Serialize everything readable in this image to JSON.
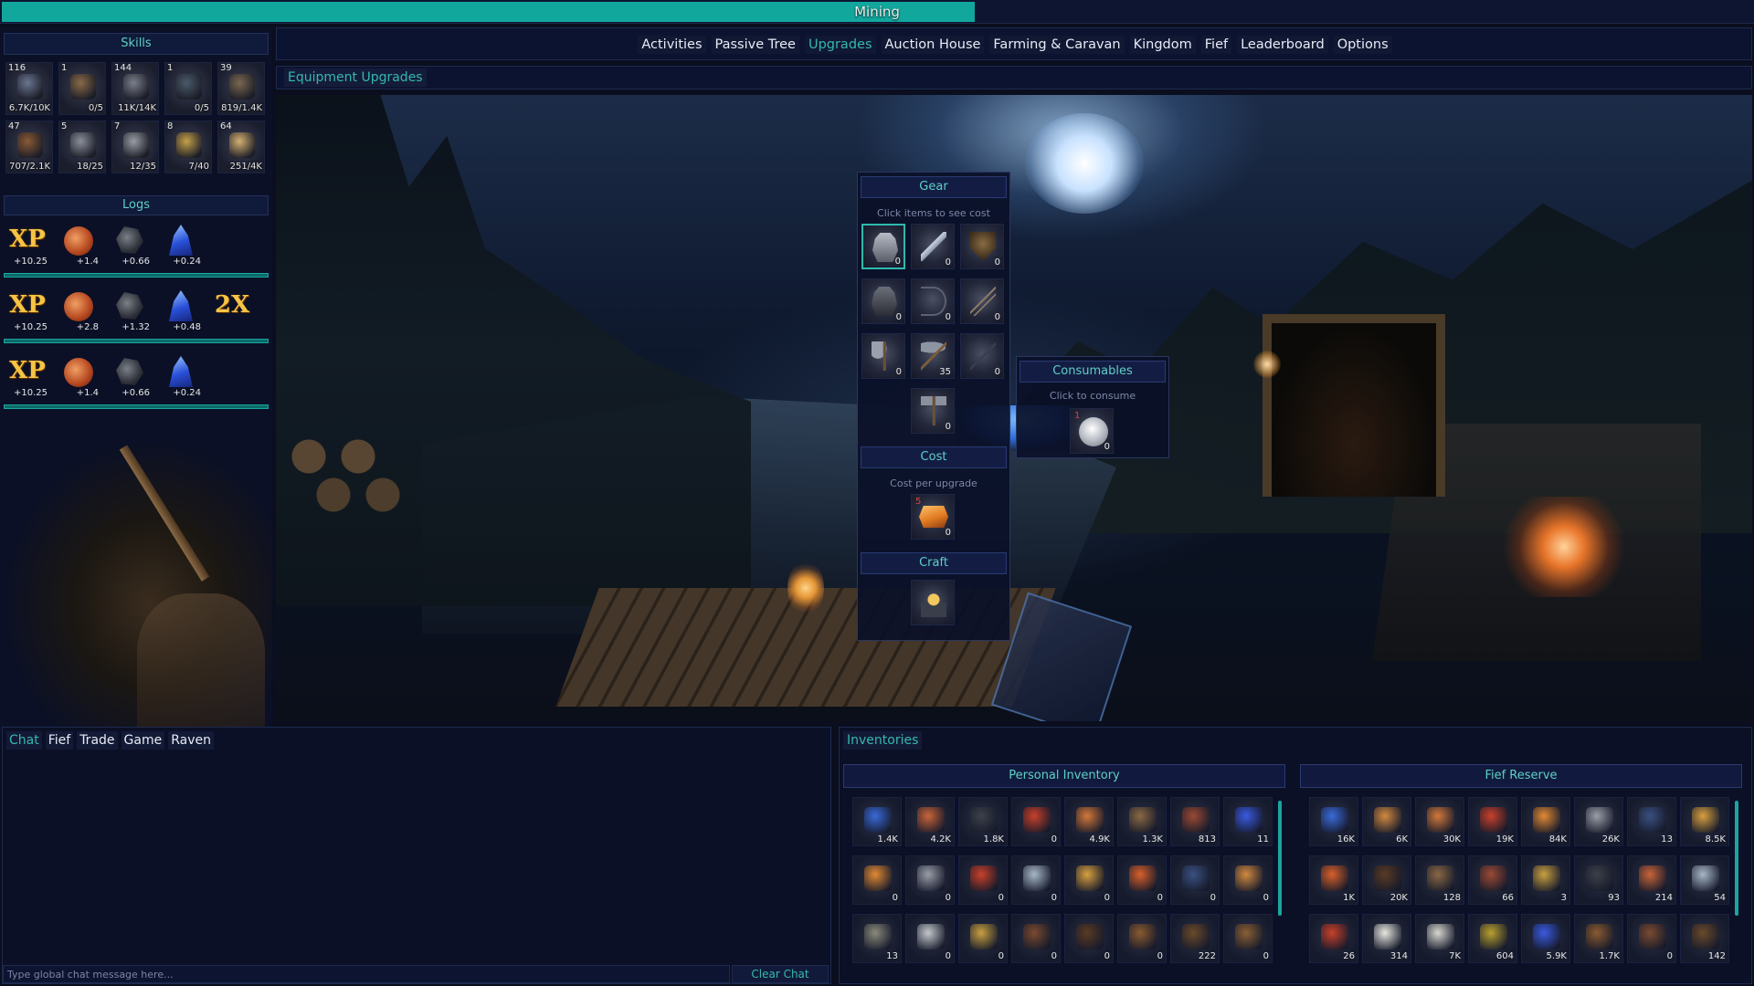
{
  "top_bar": {
    "title": "Mining",
    "progress_fraction": 0.556,
    "color": "#12a79d"
  },
  "left": {
    "skills_title": "Skills",
    "skills": [
      {
        "level": "116",
        "progress": "6.7K/10K",
        "icon": "stag-icon",
        "color": "#6a7590"
      },
      {
        "level": "1",
        "progress": "0/5",
        "icon": "wood-axe-icon",
        "color": "#8a6a48"
      },
      {
        "level": "144",
        "progress": "11K/14K",
        "icon": "pickaxe-icon",
        "color": "#7a7f8c"
      },
      {
        "level": "1",
        "progress": "0/5",
        "icon": "fishing-net-icon",
        "color": "#4a5a6a"
      },
      {
        "level": "39",
        "progress": "819/1.4K",
        "icon": "fishing-rod-icon",
        "color": "#7a6850"
      },
      {
        "level": "47",
        "progress": "707/2.1K",
        "icon": "crafting-chest-icon",
        "color": "#8a5a34"
      },
      {
        "level": "5",
        "progress": "18/25",
        "icon": "crossed-swords-icon",
        "color": "#8a8f9a"
      },
      {
        "level": "7",
        "progress": "12/35",
        "icon": "armor-icon",
        "color": "#9a9ca4"
      },
      {
        "level": "8",
        "progress": "7/40",
        "icon": "anvil-icon",
        "color": "#c4a04a"
      },
      {
        "level": "64",
        "progress": "251/4K",
        "icon": "scroll-icon",
        "color": "#d4b070"
      }
    ],
    "logs_title": "Logs",
    "log_rows": [
      {
        "items": [
          {
            "kind": "xp",
            "label": "XP",
            "amount": "+10.25"
          },
          {
            "kind": "ore",
            "amount": "+1.4"
          },
          {
            "kind": "coal",
            "amount": "+0.66"
          },
          {
            "kind": "crys",
            "amount": "+0.24"
          }
        ]
      },
      {
        "items": [
          {
            "kind": "xp",
            "label": "XP",
            "amount": "+10.25"
          },
          {
            "kind": "ore",
            "amount": "+2.8"
          },
          {
            "kind": "coal",
            "amount": "+1.32"
          },
          {
            "kind": "crys",
            "amount": "+0.48"
          },
          {
            "kind": "mult",
            "label": "2X",
            "amount": ""
          }
        ]
      },
      {
        "items": [
          {
            "kind": "xp",
            "label": "XP",
            "amount": "+10.25"
          },
          {
            "kind": "ore",
            "amount": "+1.4"
          },
          {
            "kind": "coal",
            "amount": "+0.66"
          },
          {
            "kind": "crys",
            "amount": "+0.24"
          }
        ]
      }
    ]
  },
  "nav": {
    "tabs": [
      {
        "label": "Activities",
        "active": false
      },
      {
        "label": "Passive Tree",
        "active": false
      },
      {
        "label": "Upgrades",
        "active": true
      },
      {
        "label": "Auction House",
        "active": false
      },
      {
        "label": "Farming & Caravan",
        "active": false
      },
      {
        "label": "Kingdom",
        "active": false
      },
      {
        "label": "Fief",
        "active": false
      },
      {
        "label": "Leaderboard",
        "active": false
      },
      {
        "label": "Options",
        "active": false
      }
    ]
  },
  "sub_title": "Equipment Upgrades",
  "gear": {
    "title": "Gear",
    "hint": "Click items to see cost",
    "slots": [
      {
        "icon": "plate-armor-icon",
        "count": "0",
        "selected": true,
        "cls": "i-armor"
      },
      {
        "icon": "sword-icon",
        "count": "0",
        "selected": false,
        "cls": "i-sword"
      },
      {
        "icon": "shield-icon",
        "count": "0",
        "selected": false,
        "cls": "i-shield"
      },
      {
        "icon": "dark-armor-icon",
        "count": "0",
        "selected": false,
        "cls": "i-armor-dark"
      },
      {
        "icon": "bow-icon",
        "count": "0",
        "selected": false,
        "cls": "i-bow"
      },
      {
        "icon": "arrows-icon",
        "count": "0",
        "selected": false,
        "cls": "i-arrows"
      },
      {
        "icon": "axe-icon",
        "count": "0",
        "selected": false,
        "cls": "i-axe"
      },
      {
        "icon": "pickaxe-icon",
        "count": "35",
        "selected": false,
        "cls": "i-pick"
      },
      {
        "icon": "staff-icon",
        "count": "0",
        "selected": false,
        "cls": "i-staff"
      },
      {
        "icon": "hammer-icon",
        "count": "0",
        "selected": false,
        "cls": "i-hammer"
      }
    ],
    "cost_title": "Cost",
    "cost_hint": "Cost per upgrade",
    "cost_item": {
      "icon": "copper-bars-icon",
      "required": "5",
      "count": "0"
    },
    "craft_title": "Craft",
    "craft_icon": "anvil-hammer-icon"
  },
  "consumables": {
    "title": "Consumables",
    "hint": "Click to consume",
    "item": {
      "icon": "silver-coin-icon",
      "required": "1",
      "count": "0"
    }
  },
  "chat": {
    "tabs": [
      {
        "label": "Chat",
        "active": true
      },
      {
        "label": "Fief",
        "active": false
      },
      {
        "label": "Trade",
        "active": false
      },
      {
        "label": "Game",
        "active": false
      },
      {
        "label": "Raven",
        "active": false
      }
    ],
    "placeholder": "Type global chat message here...",
    "clear_label": "Clear Chat"
  },
  "inventories": {
    "title": "Inventories",
    "personal": {
      "title": "Personal Inventory",
      "items": [
        {
          "icon": "blue-ore-icon",
          "qty": "1.4K",
          "color": "#3a6ad8"
        },
        {
          "icon": "copper-ore-icon",
          "qty": "4.2K",
          "color": "#c8643a"
        },
        {
          "icon": "coal-icon",
          "qty": "1.8K",
          "color": "#3c4048"
        },
        {
          "icon": "lobster-icon",
          "qty": "0",
          "color": "#c8402a"
        },
        {
          "icon": "cooked-food-icon",
          "qty": "4.9K",
          "color": "#d2783a"
        },
        {
          "icon": "logs-icon",
          "qty": "1.3K",
          "color": "#8a6844"
        },
        {
          "icon": "red-logs-icon",
          "qty": "813",
          "color": "#9a4a34"
        },
        {
          "icon": "blue-crystal-icon",
          "qty": "11",
          "color": "#3a5ae0"
        },
        {
          "icon": "copper-bars-icon",
          "qty": "0",
          "color": "#e28a34"
        },
        {
          "icon": "iron-bars-icon",
          "qty": "0",
          "color": "#9a9ea8"
        },
        {
          "icon": "lobster-icon",
          "qty": "0",
          "color": "#c8402a"
        },
        {
          "icon": "fish-icon",
          "qty": "0",
          "color": "#a8b8c8"
        },
        {
          "icon": "gold-bars-icon",
          "qty": "0",
          "color": "#d8a040"
        },
        {
          "icon": "copper-ingot-icon",
          "qty": "0",
          "color": "#d8602a"
        },
        {
          "icon": "ore-basket-icon",
          "qty": "0",
          "color": "#3a5080"
        },
        {
          "icon": "bread-icon",
          "qty": "0",
          "color": "#d28a40"
        },
        {
          "icon": "compass-icon",
          "qty": "13",
          "color": "#8a8a7a"
        },
        {
          "icon": "silver-coin-icon",
          "qty": "0",
          "color": "#c4c8cc"
        },
        {
          "icon": "wheat-icon",
          "qty": "0",
          "color": "#c8a040"
        },
        {
          "icon": "plank-icon",
          "qty": "0",
          "color": "#7a4a30"
        },
        {
          "icon": "dark-plank-icon",
          "qty": "0",
          "color": "#5a3a24"
        },
        {
          "icon": "barrel-icon",
          "qty": "0",
          "color": "#8a5a30"
        },
        {
          "icon": "nest-icon",
          "qty": "222",
          "color": "#6a4a2a"
        },
        {
          "icon": "chest-icon",
          "qty": "0",
          "color": "#8a6034"
        }
      ]
    },
    "fief": {
      "title": "Fief Reserve",
      "items": [
        {
          "icon": "blue-ore-icon",
          "qty": "16K",
          "color": "#3a6ad8"
        },
        {
          "icon": "bread-icon",
          "qty": "6K",
          "color": "#d28a40"
        },
        {
          "icon": "cooked-food-icon",
          "qty": "30K",
          "color": "#d2783a"
        },
        {
          "icon": "lobster-icon",
          "qty": "19K",
          "color": "#c8402a"
        },
        {
          "icon": "copper-bars-icon",
          "qty": "84K",
          "color": "#e28a34"
        },
        {
          "icon": "iron-bars-icon",
          "qty": "26K",
          "color": "#9a9ea8"
        },
        {
          "icon": "ore-basket-icon",
          "qty": "13",
          "color": "#3a5080"
        },
        {
          "icon": "gold-bars-icon",
          "qty": "8.5K",
          "color": "#d8a040"
        },
        {
          "icon": "copper-ingot-icon",
          "qty": "1K",
          "color": "#d8602a"
        },
        {
          "icon": "dark-plank-icon",
          "qty": "20K",
          "color": "#5a3a24"
        },
        {
          "icon": "logs-icon",
          "qty": "128",
          "color": "#8a6844"
        },
        {
          "icon": "red-logs-icon",
          "qty": "66",
          "color": "#9a4a34"
        },
        {
          "icon": "wheat-icon",
          "qty": "3",
          "color": "#c8a040"
        },
        {
          "icon": "coal-icon",
          "qty": "93",
          "color": "#3c4048"
        },
        {
          "icon": "copper-ore-icon",
          "qty": "214",
          "color": "#c8643a"
        },
        {
          "icon": "fish-icon",
          "qty": "54",
          "color": "#a8b8c8"
        },
        {
          "icon": "lobster-icon",
          "qty": "26",
          "color": "#c8402a"
        },
        {
          "icon": "cotton-icon",
          "qty": "314",
          "color": "#e8e8e0"
        },
        {
          "icon": "mushroom-icon",
          "qty": "7K",
          "color": "#d8d8d0"
        },
        {
          "icon": "herb-icon",
          "qty": "604",
          "color": "#b8a030"
        },
        {
          "icon": "blue-crystal-icon",
          "qty": "5.9K",
          "color": "#3a5ae0"
        },
        {
          "icon": "barrel-icon",
          "qty": "1.7K",
          "color": "#8a5a30"
        },
        {
          "icon": "plank-icon",
          "qty": "0",
          "color": "#7a4a30"
        },
        {
          "icon": "nest-icon",
          "qty": "142",
          "color": "#6a4a2a"
        }
      ]
    }
  }
}
